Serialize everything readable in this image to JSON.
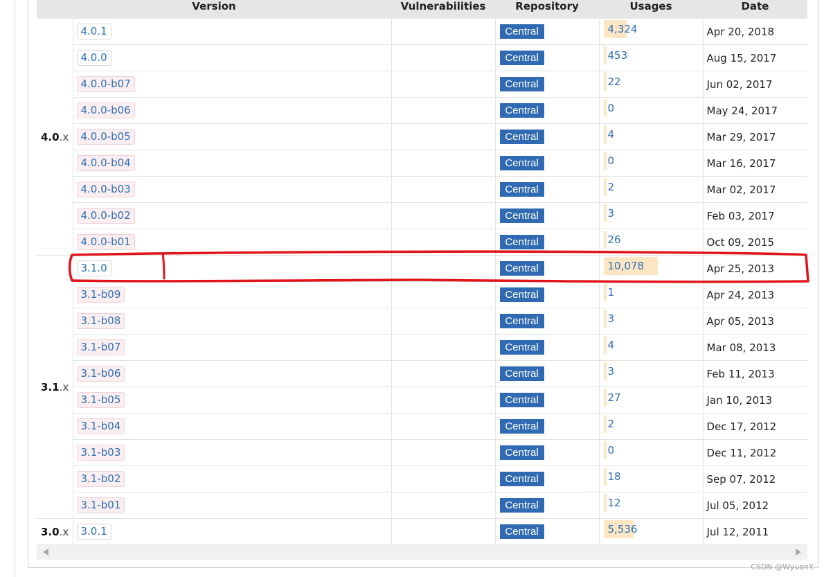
{
  "headers": {
    "version": "Version",
    "vulnerabilities": "Vulnerabilities",
    "repository": "Repository",
    "usages": "Usages",
    "date": "Date"
  },
  "groups": [
    {
      "major": "4.0",
      "suffix": ".x",
      "rows": [
        {
          "version": "4.0.1",
          "beta": false,
          "repo": "Central",
          "usages": "4,324",
          "date": "Apr 20, 2018"
        },
        {
          "version": "4.0.0",
          "beta": false,
          "repo": "Central",
          "usages": "453",
          "date": "Aug 15, 2017"
        },
        {
          "version": "4.0.0-b07",
          "beta": true,
          "repo": "Central",
          "usages": "22",
          "date": "Jun 02, 2017"
        },
        {
          "version": "4.0.0-b06",
          "beta": true,
          "repo": "Central",
          "usages": "0",
          "date": "May 24, 2017"
        },
        {
          "version": "4.0.0-b05",
          "beta": true,
          "repo": "Central",
          "usages": "4",
          "date": "Mar 29, 2017"
        },
        {
          "version": "4.0.0-b04",
          "beta": true,
          "repo": "Central",
          "usages": "0",
          "date": "Mar 16, 2017"
        },
        {
          "version": "4.0.0-b03",
          "beta": true,
          "repo": "Central",
          "usages": "2",
          "date": "Mar 02, 2017"
        },
        {
          "version": "4.0.0-b02",
          "beta": true,
          "repo": "Central",
          "usages": "3",
          "date": "Feb 03, 2017"
        },
        {
          "version": "4.0.0-b01",
          "beta": true,
          "repo": "Central",
          "usages": "26",
          "date": "Oct 09, 2015"
        }
      ]
    },
    {
      "major": "3.1",
      "suffix": ".x",
      "rows": [
        {
          "version": "3.1.0",
          "beta": false,
          "repo": "Central",
          "usages": "10,078",
          "date": "Apr 25, 2013"
        },
        {
          "version": "3.1-b09",
          "beta": true,
          "repo": "Central",
          "usages": "1",
          "date": "Apr 24, 2013"
        },
        {
          "version": "3.1-b08",
          "beta": true,
          "repo": "Central",
          "usages": "3",
          "date": "Apr 05, 2013"
        },
        {
          "version": "3.1-b07",
          "beta": true,
          "repo": "Central",
          "usages": "4",
          "date": "Mar 08, 2013"
        },
        {
          "version": "3.1-b06",
          "beta": true,
          "repo": "Central",
          "usages": "3",
          "date": "Feb 11, 2013"
        },
        {
          "version": "3.1-b05",
          "beta": true,
          "repo": "Central",
          "usages": "27",
          "date": "Jan 10, 2013"
        },
        {
          "version": "3.1-b04",
          "beta": true,
          "repo": "Central",
          "usages": "2",
          "date": "Dec 17, 2012"
        },
        {
          "version": "3.1-b03",
          "beta": true,
          "repo": "Central",
          "usages": "0",
          "date": "Dec 11, 2012"
        },
        {
          "version": "3.1-b02",
          "beta": true,
          "repo": "Central",
          "usages": "18",
          "date": "Sep 07, 2012"
        },
        {
          "version": "3.1-b01",
          "beta": true,
          "repo": "Central",
          "usages": "12",
          "date": "Jul 05, 2012"
        }
      ]
    },
    {
      "major": "3.0",
      "suffix": ".x",
      "rows": [
        {
          "version": "3.0.1",
          "beta": false,
          "repo": "Central",
          "usages": "5,536",
          "date": "Jul 12, 2011"
        }
      ]
    }
  ],
  "usage_scale_max": 10078,
  "watermark": "CSDN @WyuanY.",
  "colors": {
    "central_badge": "#2f6ab2",
    "version_link": "#2c6fb6",
    "beta_tag_bg": "#fbeef1",
    "usage_bar": "#fde6c4",
    "annotation_red": "#e0141b"
  }
}
